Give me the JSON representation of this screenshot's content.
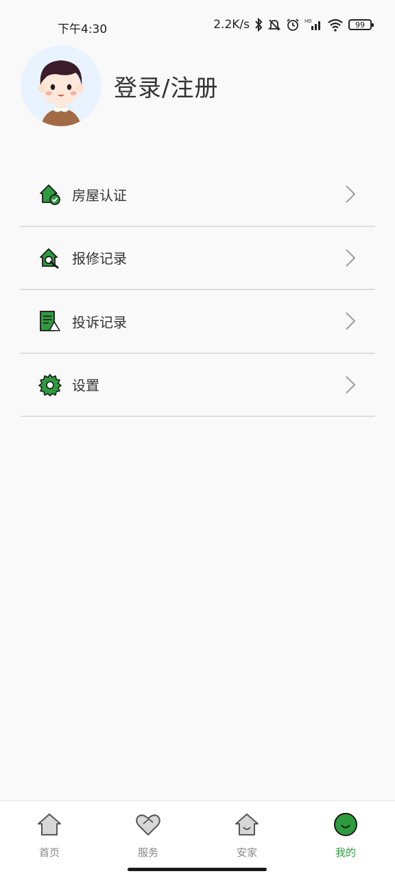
{
  "status_bar": {
    "time": "下午4:30",
    "network_speed": "2.2K/s",
    "battery": "99",
    "icons": [
      "bluetooth-icon",
      "mute-icon",
      "alarm-icon",
      "hd-signal-icon",
      "wifi-icon",
      "battery-icon"
    ]
  },
  "profile": {
    "login_text": "登录/注册"
  },
  "menu": {
    "items": [
      {
        "label": "房屋认证",
        "icon": "house-verify-icon"
      },
      {
        "label": "报修记录",
        "icon": "repair-icon"
      },
      {
        "label": "投诉记录",
        "icon": "complaint-icon"
      },
      {
        "label": "设置",
        "icon": "gear-icon"
      }
    ]
  },
  "bottom_nav": {
    "items": [
      {
        "label": "首页",
        "icon": "home-icon",
        "active": false
      },
      {
        "label": "服务",
        "icon": "heart-icon",
        "active": false
      },
      {
        "label": "安家",
        "icon": "house-smile-icon",
        "active": false
      },
      {
        "label": "我的",
        "icon": "smile-circle-icon",
        "active": true
      }
    ]
  },
  "colors": {
    "accent": "#2e9b3e",
    "background": "#f9f9f9",
    "divider": "#dedede"
  }
}
